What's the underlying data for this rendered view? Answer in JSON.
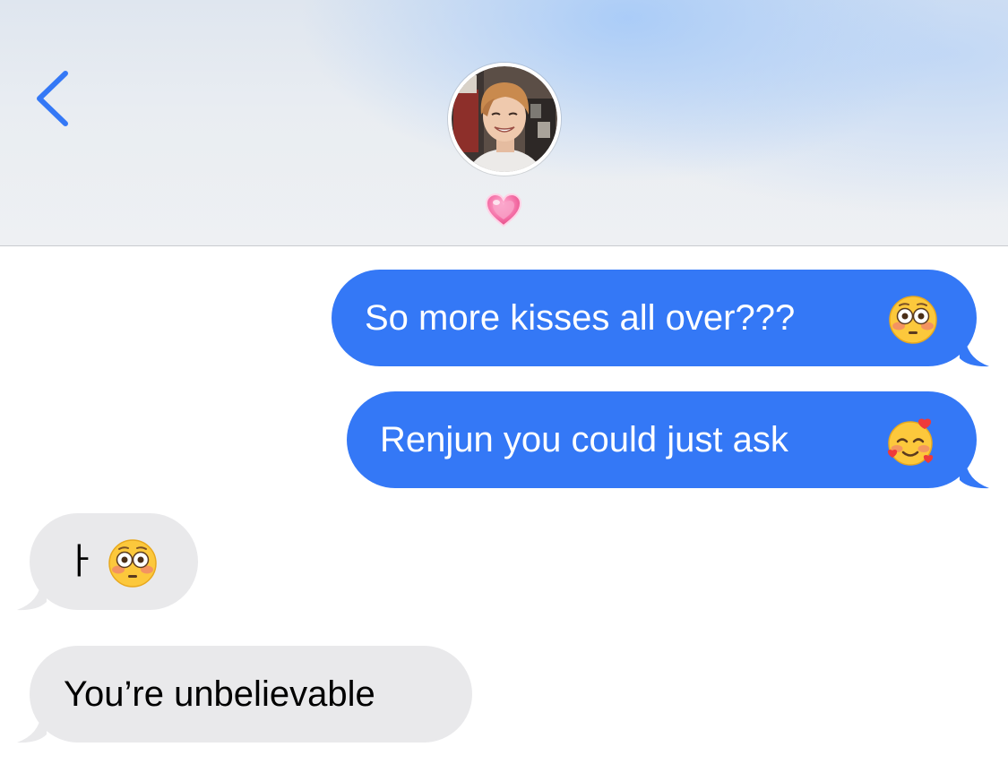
{
  "header": {
    "back_icon": "chevron-left-icon",
    "contact_avatar": "contact-avatar-photo",
    "contact_name_emoji": "💗",
    "colors": {
      "accent": "#3478f6"
    }
  },
  "messages": [
    {
      "direction": "sent",
      "text": "So more kisses all over???",
      "emoji": "😳"
    },
    {
      "direction": "sent",
      "text": "Renjun you could just ask",
      "emoji": "🥰"
    },
    {
      "direction": "received",
      "text": "ㅏ",
      "emoji": "😳"
    },
    {
      "direction": "received",
      "text": "You’re unbelievable"
    }
  ],
  "colors": {
    "sent_bubble": "#3478f6",
    "received_bubble": "#e9e9eb"
  }
}
